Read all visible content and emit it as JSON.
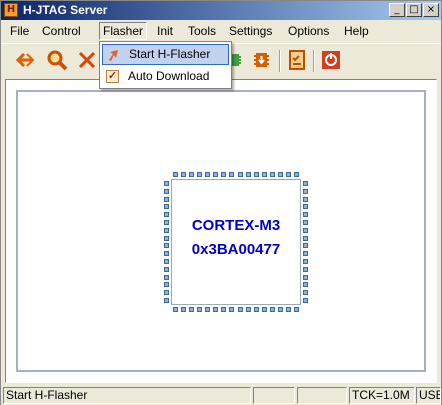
{
  "window": {
    "title": "H-JTAG Server",
    "app_icon_letter": "H"
  },
  "titlebar_buttons": {
    "minimize": "_",
    "maximize": "□",
    "close": "×"
  },
  "menubar": {
    "items": [
      "File",
      "Control",
      "Flasher",
      "Init",
      "Tools",
      "Settings",
      "Options",
      "Help"
    ],
    "active": "Flasher"
  },
  "toolbar": {
    "icons": [
      "connect-arrow-icon",
      "search-icon",
      "delete-x-icon",
      "chip-icon",
      "chip-download-icon",
      "checklist-icon",
      "power-icon"
    ]
  },
  "flasher_menu": {
    "items": [
      {
        "label": "Start H-Flasher",
        "icon": "flasher-icon",
        "highlighted": true
      },
      {
        "label": "Auto Download",
        "checked": true,
        "highlighted": false
      }
    ]
  },
  "target": {
    "name": "CORTEX-M3",
    "id": "0x3BA00477"
  },
  "statusbar": {
    "message": "Start H-Flasher",
    "panel2": "",
    "panel3": "",
    "tck": "TCK=1.0M",
    "interface": "USB"
  },
  "colors": {
    "title_gradient_start": "#0a246a",
    "chip_text": "#0000cc",
    "pin": "#8fb1d4"
  }
}
